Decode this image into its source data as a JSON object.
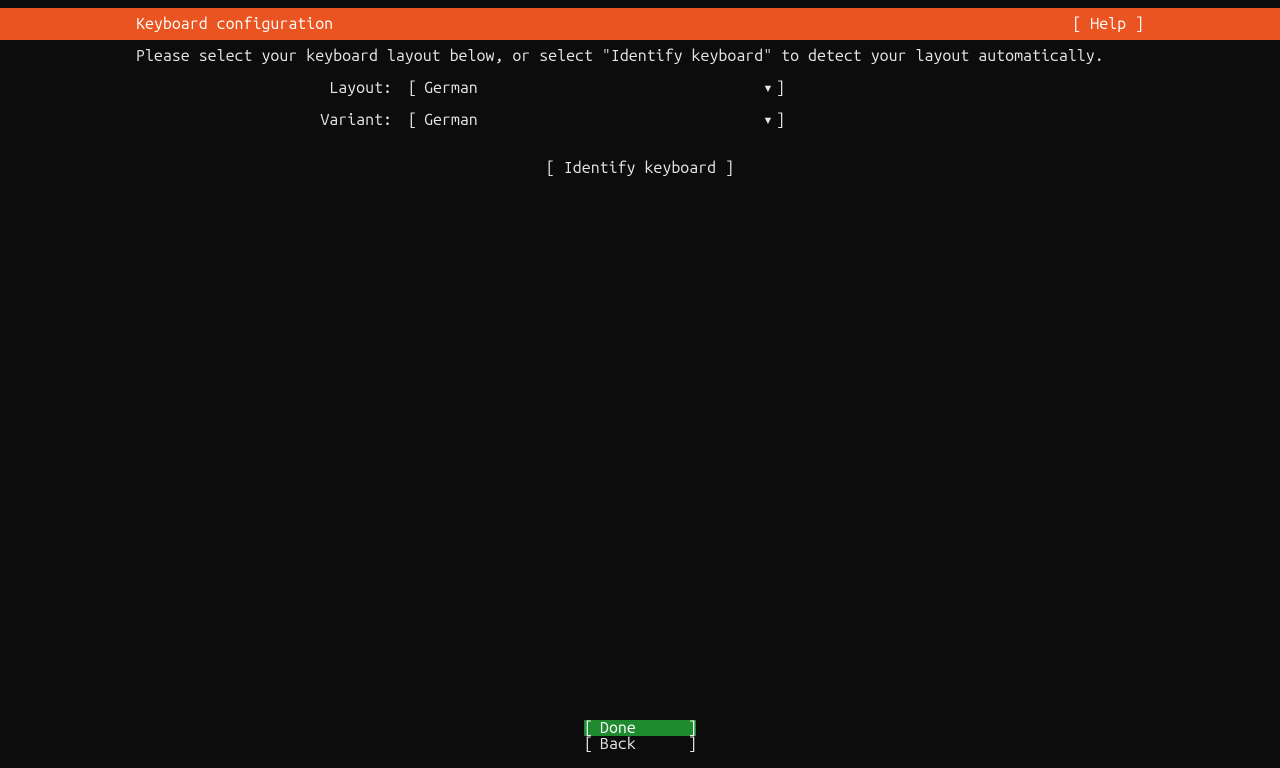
{
  "header": {
    "title": "Keyboard configuration",
    "help": "[ Help ]"
  },
  "instruction": "Please select your keyboard layout below, or select \"Identify keyboard\" to detect your layout automatically.",
  "fields": {
    "layout": {
      "label": "Layout:",
      "value": "German"
    },
    "variant": {
      "label": "Variant:",
      "value": "German"
    }
  },
  "brackets": {
    "open": "[",
    "close": "]",
    "arrow": "▾"
  },
  "identify": "[ Identify keyboard ]",
  "buttons": {
    "done": "Done",
    "back": "Back"
  }
}
